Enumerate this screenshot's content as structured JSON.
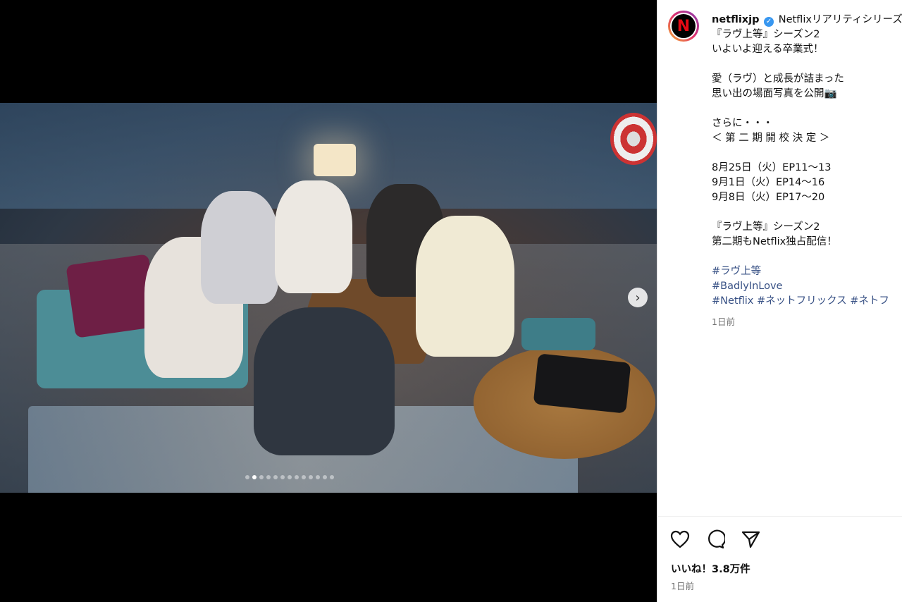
{
  "post": {
    "username": "netflixjp",
    "avatar_letter": "N",
    "caption_first": "Netflixリアリティシリーズ",
    "caption_lines": [
      "『ラヴ上等』シーズン2",
      "いよいよ迎える卒業式！",
      "",
      "愛（ラヴ）と成長が詰まった",
      "思い出の場面写真を公開📷",
      "",
      "さらに・・・",
      "＜ 第 二 期 開 校 決 定 ＞",
      "",
      "8月25日（火）EP11〜13",
      "9月1日（火）EP14〜16",
      "9月8日（火）EP17〜20",
      "",
      "『ラヴ上等』シーズン2",
      "第二期もNetflix独占配信！",
      ""
    ],
    "hashtags": [
      "#ラヴ上等",
      "#BadlyInLove",
      "#Netflix #ネットフリックス #ネトフ"
    ],
    "caption_time": "1日前",
    "likes": "いいね！3.8万件",
    "date": "1日前"
  },
  "carousel": {
    "dot_count": 13,
    "active_index": 1
  },
  "colors": {
    "link": "#385185",
    "verified": "#3897f0",
    "netflix_red": "#e50914"
  },
  "icons": [
    "heart-icon",
    "comment-icon",
    "share-icon",
    "chevron-right-icon",
    "verified-badge-icon"
  ]
}
